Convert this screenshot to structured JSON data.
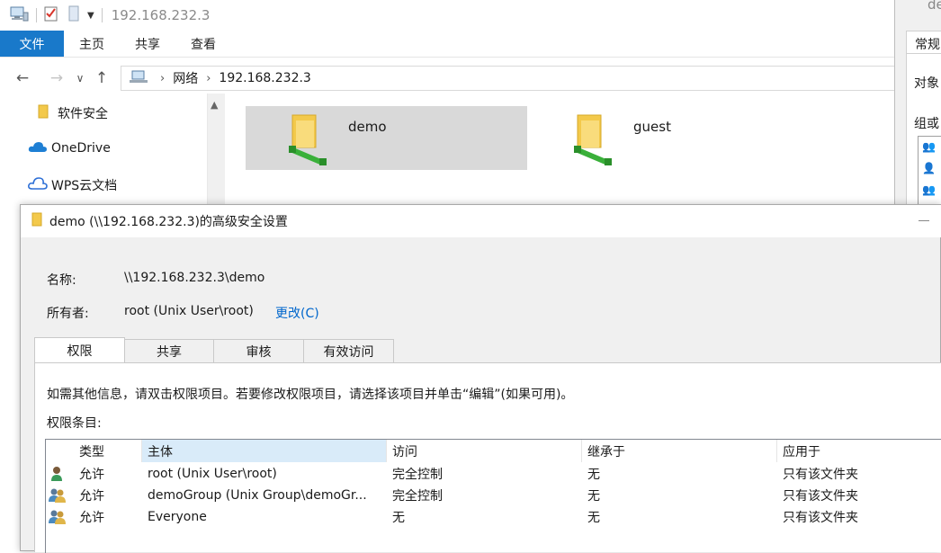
{
  "explorer": {
    "window_title": "192.168.232.3",
    "ribbon_tabs": [
      "文件",
      "主页",
      "共享",
      "查看"
    ],
    "address": {
      "segments": [
        "网络",
        "192.168.232.3"
      ]
    },
    "nav_items": [
      {
        "label": "软件安全",
        "icon": "folder-icon"
      },
      {
        "label": "OneDrive",
        "icon": "onedrive-cloud-icon"
      },
      {
        "label": "WPS云文档",
        "icon": "wps-cloud-icon"
      }
    ],
    "shares": [
      {
        "name": "demo",
        "icon": "network-share-folder-icon",
        "selected": true
      },
      {
        "name": "guest",
        "icon": "network-share-folder-icon",
        "selected": false
      }
    ]
  },
  "properties_window": {
    "title_fragment": "de",
    "tab_fragment": "常规",
    "row1_fragment": "对象",
    "row2_fragment": "组或"
  },
  "dialog": {
    "title": "demo (\\\\192.168.232.3)的高级安全设置",
    "name_label": "名称:",
    "name_value": "\\\\192.168.232.3\\demo",
    "owner_label": "所有者:",
    "owner_value": "root (Unix User\\root)",
    "change_link": "更改(C)",
    "tabs": [
      "权限",
      "共享",
      "审核",
      "有效访问"
    ],
    "active_tab": "权限",
    "info_text": "如需其他信息，请双击权限项目。若要修改权限项目，请选择该项目并单击“编辑”(如果可用)。",
    "entries_label": "权限条目:",
    "columns": [
      "类型",
      "主体",
      "访问",
      "继承于",
      "应用于"
    ],
    "sorted_column": "主体",
    "rows": [
      {
        "icon": "user-icon",
        "type": "允许",
        "principal": "root (Unix User\\root)",
        "access": "完全控制",
        "inherited": "无",
        "applies": "只有该文件夹"
      },
      {
        "icon": "group-icon",
        "type": "允许",
        "principal": "demoGroup (Unix Group\\demoGr...",
        "access": "完全控制",
        "inherited": "无",
        "applies": "只有该文件夹"
      },
      {
        "icon": "group-icon",
        "type": "允许",
        "principal": "Everyone",
        "access": "无",
        "inherited": "无",
        "applies": "只有该文件夹"
      }
    ]
  },
  "colors": {
    "file_tab": "#1979ca",
    "selection": "#d9d9d9",
    "sorted_header": "#d9ebf9",
    "link": "#0066cc",
    "folder": "#f3c94b",
    "share_cable": "#3ab03a"
  }
}
